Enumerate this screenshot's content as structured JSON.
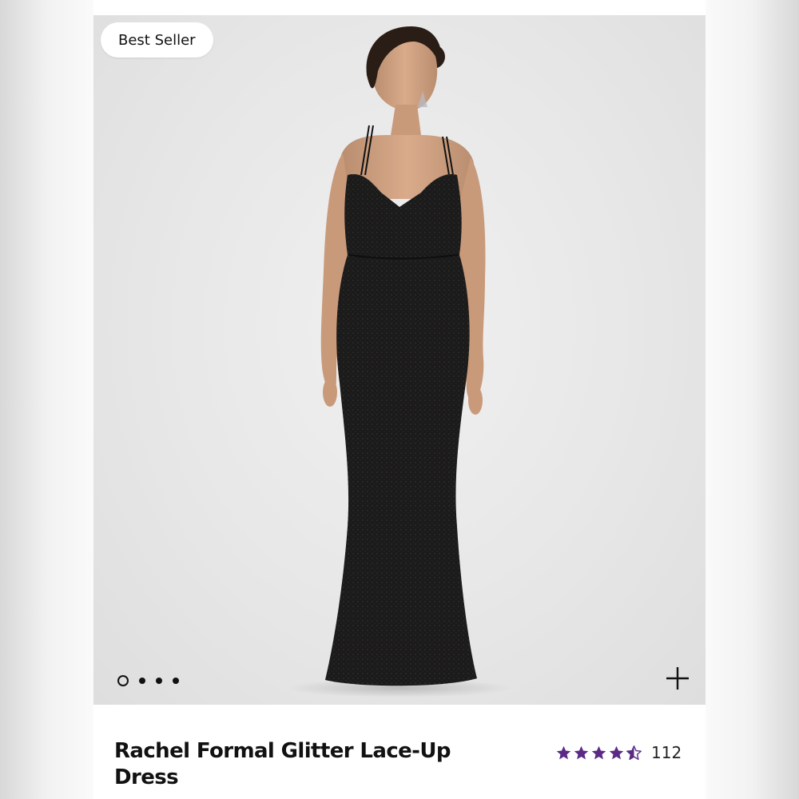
{
  "product": {
    "badge": "Best Seller",
    "title": "Rachel Formal Glitter Lace-Up Dress",
    "rating": 4.5,
    "rating_max": 5,
    "review_count": "112"
  },
  "carousel": {
    "slide_count": 4,
    "active_index": 0
  },
  "colors": {
    "star": "#5b2a86",
    "text": "#111111",
    "dress": "#1b1b1b"
  },
  "icons": {
    "expand": "plus-icon",
    "rating": "star-icon"
  }
}
